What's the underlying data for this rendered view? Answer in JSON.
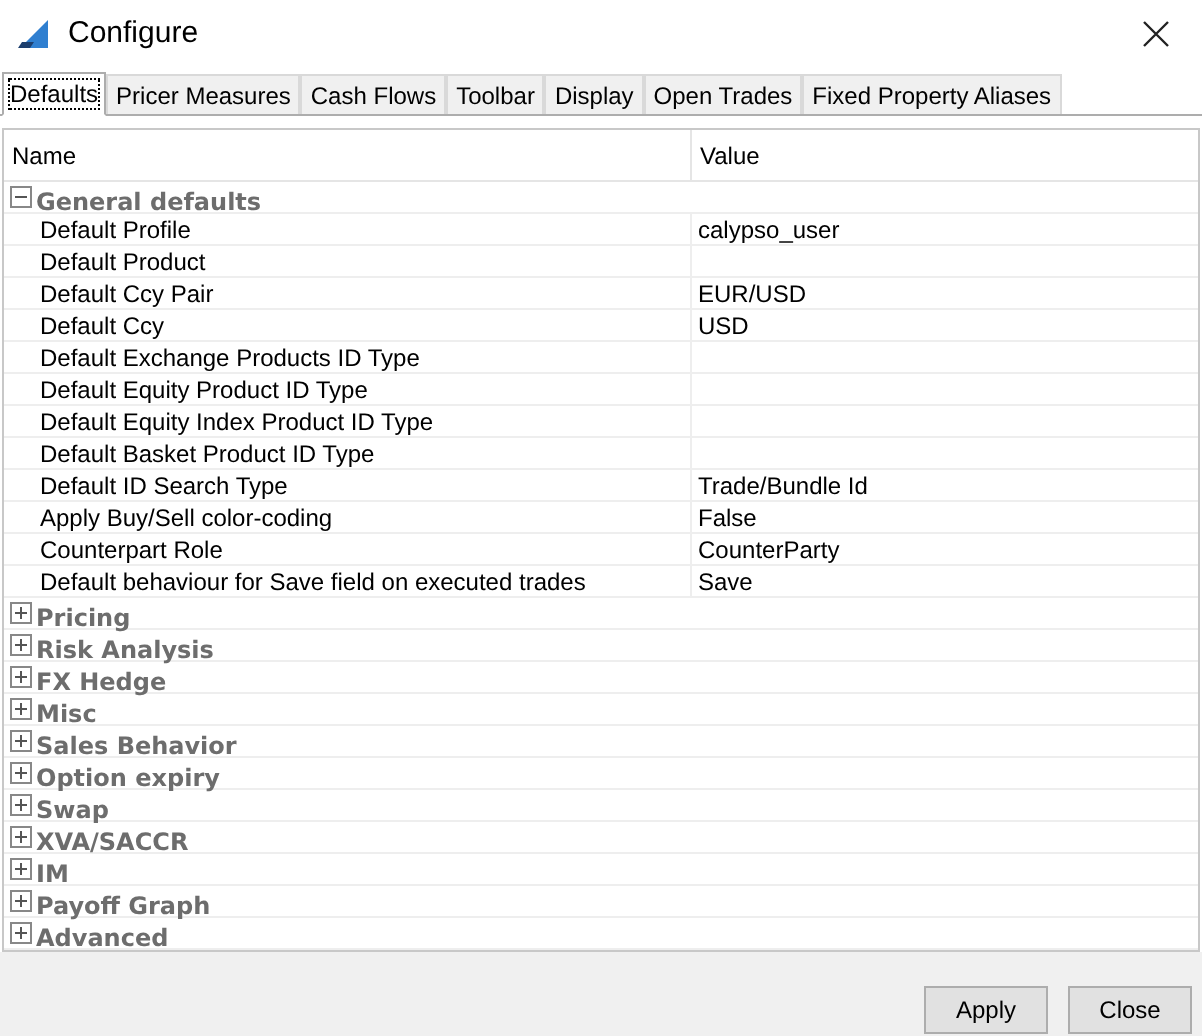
{
  "window": {
    "title": "Configure"
  },
  "tabs": [
    {
      "label": "Defaults",
      "selected": true
    },
    {
      "label": "Pricer Measures",
      "selected": false
    },
    {
      "label": "Cash Flows",
      "selected": false
    },
    {
      "label": "Toolbar",
      "selected": false
    },
    {
      "label": "Display",
      "selected": false
    },
    {
      "label": "Open Trades",
      "selected": false
    },
    {
      "label": "Fixed Property Aliases",
      "selected": false
    }
  ],
  "table": {
    "columns": [
      "Name",
      "Value"
    ],
    "groups": [
      {
        "name": "General defaults",
        "expanded": true,
        "rows": [
          {
            "name": "Default Profile",
            "value": "calypso_user"
          },
          {
            "name": "Default Product"
          },
          {
            "name": "Default Ccy Pair",
            "value": "EUR/USD"
          },
          {
            "name": "Default Ccy",
            "value": "USD"
          },
          {
            "name": "Default Exchange Products ID Type"
          },
          {
            "name": "Default Equity Product ID Type"
          },
          {
            "name": "Default Equity Index Product ID Type"
          },
          {
            "name": "Default Basket Product ID Type"
          },
          {
            "name": "Default ID Search Type",
            "value": "Trade/Bundle Id"
          },
          {
            "name": "Apply Buy/Sell color-coding",
            "value": "False"
          },
          {
            "name": "Counterpart Role",
            "value": "CounterParty"
          },
          {
            "name": "Default behaviour for Save field on executed trades",
            "value": "Save"
          }
        ]
      },
      {
        "name": "Pricing",
        "expanded": false
      },
      {
        "name": "Risk Analysis",
        "expanded": false
      },
      {
        "name": "FX Hedge",
        "expanded": false
      },
      {
        "name": "Misc",
        "expanded": false
      },
      {
        "name": "Sales Behavior",
        "expanded": false
      },
      {
        "name": "Option expiry",
        "expanded": false
      },
      {
        "name": "Swap",
        "expanded": false
      },
      {
        "name": "XVA/SACCR",
        "expanded": false
      },
      {
        "name": "IM",
        "expanded": false
      },
      {
        "name": "Payoff Graph",
        "expanded": false
      },
      {
        "name": "Advanced",
        "expanded": false
      }
    ]
  },
  "buttons": [
    "Apply",
    "Close"
  ]
}
